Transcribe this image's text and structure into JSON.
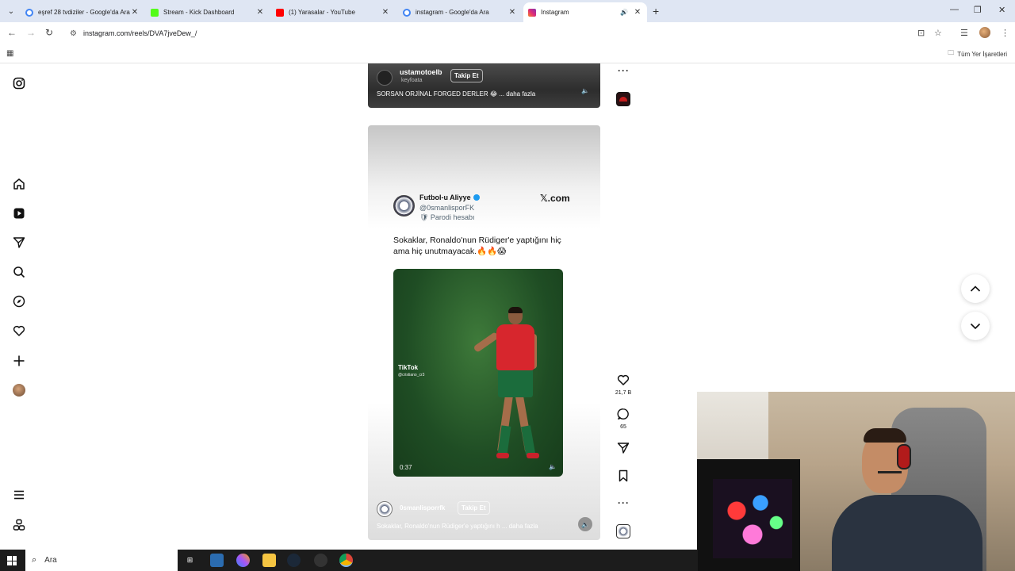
{
  "browser": {
    "tabs": [
      {
        "title": "eşref 28 tvdiziler - Google'da Ara",
        "favicon_color": "#4285f4"
      },
      {
        "title": "Stream - Kick Dashboard",
        "favicon_color": "#53fc18"
      },
      {
        "title": "(1) Yarasalar - YouTube",
        "favicon_color": "#ff0000"
      },
      {
        "title": "instagram - Google'da Ara",
        "favicon_color": "#4285f4"
      },
      {
        "title": "Instagram",
        "favicon_color": "#e1306c"
      }
    ],
    "active_tab_index": 4,
    "url": "instagram.com/reels/DVA7jveDew_/",
    "bookmarks_all_label": "Tüm Yer İşaretleri"
  },
  "reels": {
    "top": {
      "username": "ustamotoelb",
      "audio": "keyfoata",
      "follow_label": "Takip Et",
      "caption": "SORSAN ORJİNAL FORGED DERLER 😂 ... daha fazla"
    },
    "main": {
      "tweet": {
        "name": "Futbol-u Aliyye",
        "handle": "@0smanlisporFK",
        "badge": "🛡 Parodi hesabı",
        "source": "𝕏.com",
        "text": "Sokaklar, Ronaldo'nun Rüdiger'e yaptığını hiç ama hiç unutmayacak.🔥🔥😱"
      },
      "video": {
        "watermark": "TikTok",
        "watermark_handle": "@cristiano_cr3",
        "time": "0:37"
      },
      "username": "0smanlisporrfk",
      "follow_label": "Takip Et",
      "caption": "Sokaklar, Ronaldo'nun Rüdiger'e yaptığını h ... daha fazla"
    },
    "actions": {
      "likes": "21,7 B",
      "comments": "65"
    }
  },
  "taskbar": {
    "search_placeholder": "Ara"
  }
}
